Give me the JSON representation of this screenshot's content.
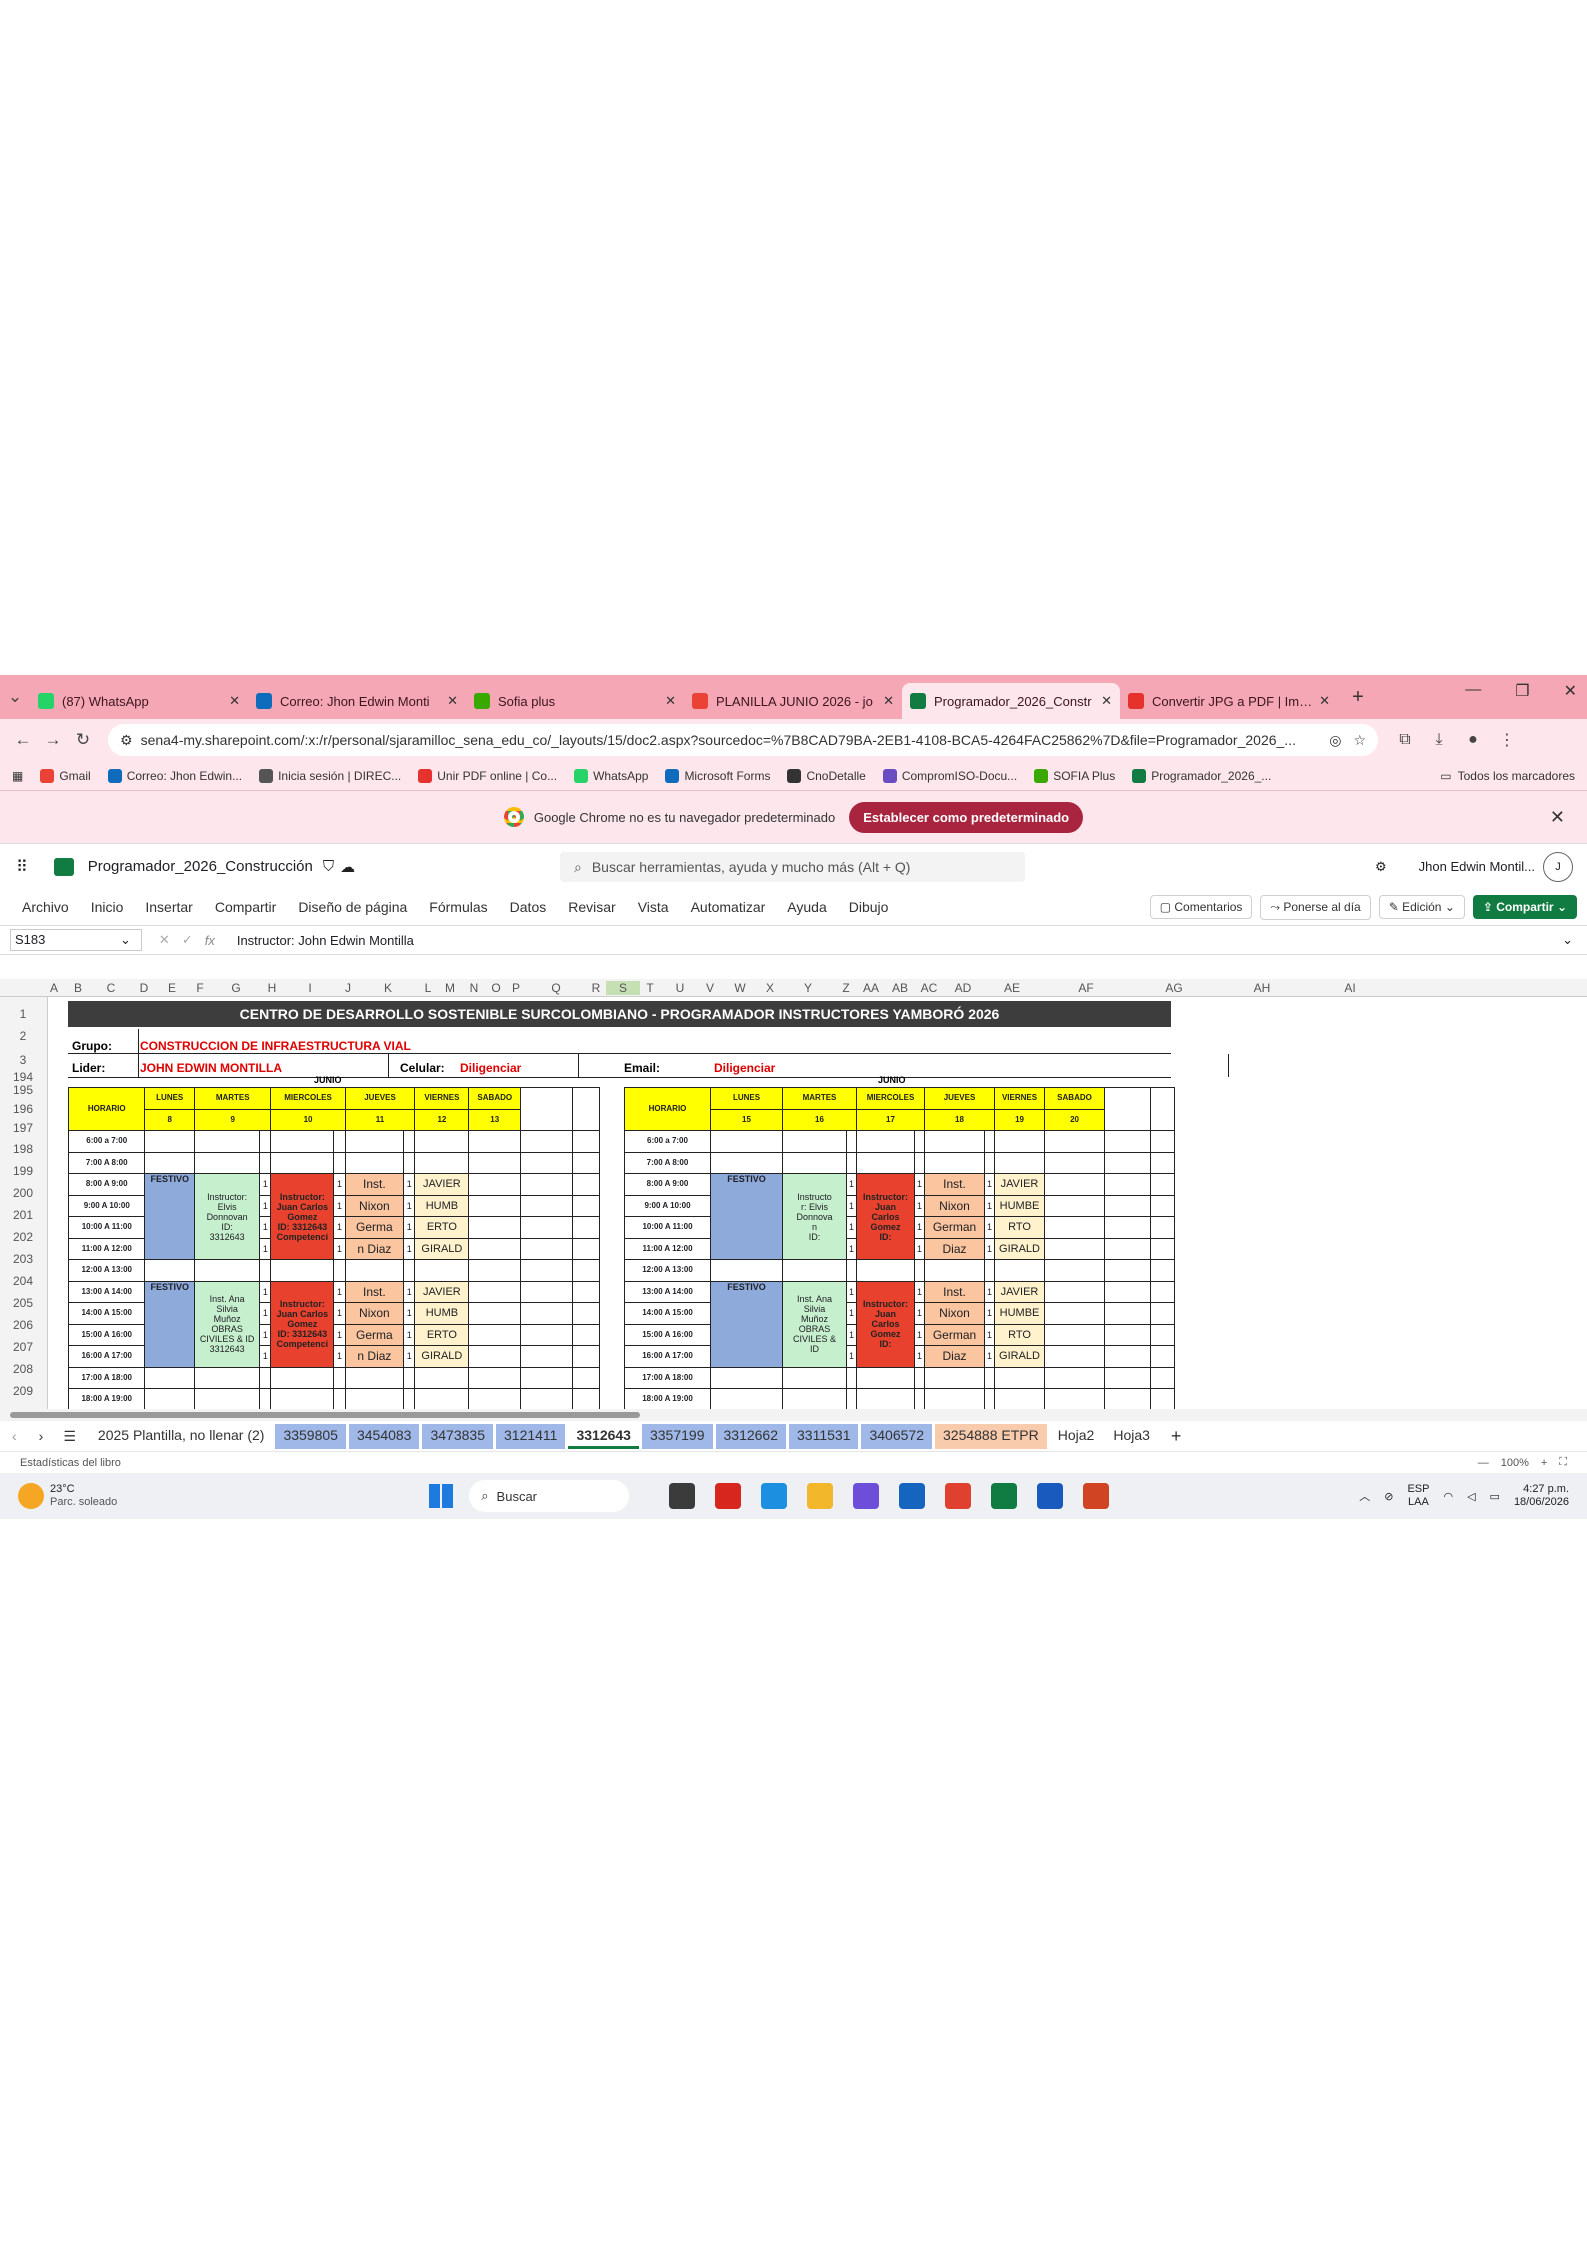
{
  "browser": {
    "tabs": [
      {
        "title": "(87) WhatsApp",
        "color": "#25d366"
      },
      {
        "title": "Correo: Jhon Edwin Monti",
        "color": "#0f6cbd"
      },
      {
        "title": "Sofia plus",
        "color": "#39a900"
      },
      {
        "title": "PLANILLA JUNIO 2026 - jo",
        "color": "#ea4335"
      },
      {
        "title": "Programador_2026_Constr",
        "color": "#107c41"
      },
      {
        "title": "Convertir JPG a PDF | Imáge",
        "color": "#e5322d"
      }
    ],
    "active_tab": 4,
    "url": "sena4-my.sharepoint.com/:x:/r/personal/sjaramilloc_sena_edu_co/_layouts/15/doc2.aspx?sourcedoc=%7B8CAD79BA-2EB1-4108-BCA5-4264FAC25862%7D&file=Programador_2026_...",
    "bookmarks": [
      "Gmail",
      "Correo: Jhon Edwin...",
      "Inicia sesión | DIREC...",
      "Unir PDF online | Co...",
      "WhatsApp",
      "Microsoft Forms",
      "CnoDetalle",
      "CompromISO-Docu...",
      "SOFIA Plus",
      "Programador_2026_..."
    ],
    "all_bookmarks": "Todos los marcadores",
    "infobar_text": "Google Chrome no es tu navegador predeterminado",
    "infobar_button": "Establecer como predeterminado"
  },
  "excel": {
    "filename": "Programador_2026_Construcción",
    "search_placeholder": "Buscar herramientas, ayuda y mucho más (Alt + Q)",
    "user": "Jhon Edwin Montil...",
    "avatar": "J",
    "ribbon_tabs": [
      "Archivo",
      "Inicio",
      "Insertar",
      "Compartir",
      "Diseño de página",
      "Fórmulas",
      "Datos",
      "Revisar",
      "Vista",
      "Automatizar",
      "Ayuda",
      "Dibujo"
    ],
    "comments": "Comentarios",
    "catchup": "Ponerse al día",
    "editing": "Edición",
    "share": "Compartir",
    "namebox": "S183",
    "formula": "Instructor: John Edwin Montilla",
    "columns": [
      "A",
      "B",
      "C",
      "D",
      "E",
      "F",
      "G",
      "H",
      "I",
      "J",
      "K",
      "L",
      "M",
      "N",
      "O",
      "P",
      "Q",
      "R",
      "S",
      "T",
      "U",
      "V",
      "W",
      "X",
      "Y",
      "Z",
      "AA",
      "AB",
      "AC",
      "AD",
      "AE",
      "AF",
      "AG",
      "AH",
      "AI"
    ],
    "rows": [
      "1",
      "2",
      "3",
      "194",
      "195",
      "196",
      "197",
      "198",
      "199",
      "200",
      "201",
      "202",
      "203",
      "204",
      "205",
      "206",
      "207",
      "208",
      "209"
    ]
  },
  "sheet": {
    "banner": "CENTRO DE DESARROLLO SOSTENIBLE SURCOLOMBIANO -  PROGRAMADOR INSTRUCTORES YAMBORÓ 2026",
    "grupo_label": "Grupo:",
    "grupo_value": "CONSTRUCCION DE INFRAESTRUCTURA VIAL",
    "lider_label": "Lider:",
    "lider_value": "JOHN EDWIN MONTILLA",
    "celular_label": "Celular:",
    "celular_value": "Diligenciar",
    "email_label": "Email:",
    "email_value": "Diligenciar",
    "month": "JUNIO",
    "horario": "HORARIO",
    "weeks": [
      {
        "days": [
          "LUNES",
          "MARTES",
          "MIERCOLES",
          "JUEVES",
          "VIERNES",
          "SABADO"
        ],
        "dates": [
          "8",
          "9",
          "10",
          "11",
          "12",
          "13"
        ],
        "hours": [
          "6:00 a 7:00",
          "7:00 A 8:00",
          "8:00 A 9:00",
          "9:00 A 10:00",
          "10:00 A 11:00",
          "11:00 A 12:00",
          "12:00 A 13:00",
          "13:00 A 14:00",
          "14:00 A 15:00",
          "15:00 A 16:00",
          "16:00 A 17:00",
          "17:00 A 18:00",
          "18:00 A 19:00"
        ],
        "festivo": "FESTIVO",
        "am": {
          "martes": [
            "Instructor:",
            "Elvis",
            "Donnovan",
            "ID:",
            "3312643"
          ],
          "miercoles": [
            "Instructor:",
            "Juan Carlos",
            "Gomez",
            "ID: 3312643",
            "Competenci"
          ],
          "jueves": [
            "Inst.",
            "Nixon",
            "Germa",
            "n Diaz"
          ],
          "viernes": [
            "JAVIER",
            "HUMB",
            "ERTO",
            "GIRALD"
          ]
        },
        "pm": {
          "martes": [
            "Inst. Ana",
            "Silvia",
            "Muñoz",
            "OBRAS",
            "CIVILES & ID",
            "3312643"
          ],
          "miercoles": [
            "Instructor:",
            "Juan Carlos",
            "Gomez",
            "ID: 3312643",
            "Competenci"
          ],
          "jueves": [
            "Inst.",
            "Nixon",
            "Germa",
            "n Diaz"
          ],
          "viernes": [
            "JAVIER",
            "HUMB",
            "ERTO",
            "GIRALD"
          ]
        }
      },
      {
        "days": [
          "LUNES",
          "MARTES",
          "MIERCOLES",
          "JUEVES",
          "VIERNES",
          "SABADO"
        ],
        "dates": [
          "15",
          "16",
          "17",
          "18",
          "19",
          "20"
        ],
        "hours": [
          "6:00 a 7:00",
          "7:00 A 8:00",
          "8:00 A 9:00",
          "9:00 A 10:00",
          "10:00 A 11:00",
          "11:00 A 12:00",
          "12:00 A 13:00",
          "13:00 A 14:00",
          "14:00 A 15:00",
          "15:00 A 16:00",
          "16:00 A 17:00",
          "17:00 A 18:00",
          "18:00 A 19:00"
        ],
        "festivo": "FESTIVO",
        "am": {
          "martes": [
            "Instructo",
            "r: Elvis",
            "Donnova",
            "n",
            "ID:"
          ],
          "miercoles": [
            "Instructor:",
            "Juan",
            "Carlos",
            "Gomez",
            "ID:"
          ],
          "jueves": [
            "Inst.",
            "Nixon",
            "German",
            "Diaz"
          ],
          "viernes": [
            "JAVIER",
            "HUMBE",
            "RTO",
            "GIRALD"
          ]
        },
        "pm": {
          "martes": [
            "Inst. Ana",
            "Silvia",
            "Muñoz",
            "OBRAS",
            "CIVILES &",
            "ID"
          ],
          "miercoles": [
            "Instructor:",
            "Juan",
            "Carlos",
            "Gomez",
            "ID:"
          ],
          "jueves": [
            "Inst.",
            "Nixon",
            "German",
            "Diaz"
          ],
          "viernes": [
            "JAVIER",
            "HUMBE",
            "RTO",
            "GIRALD"
          ]
        }
      }
    ],
    "hour_count": "1"
  },
  "sheet_tabs": [
    {
      "label": "2025 Plantilla, no llenar (2)",
      "style": "plain"
    },
    {
      "label": "3359805",
      "style": "blue"
    },
    {
      "label": "3454083",
      "style": "blue"
    },
    {
      "label": "3473835",
      "style": "blue"
    },
    {
      "label": "3121411",
      "style": "blue"
    },
    {
      "label": "3312643",
      "style": "active"
    },
    {
      "label": "3357199",
      "style": "blue"
    },
    {
      "label": "3312662",
      "style": "blue"
    },
    {
      "label": "3311531",
      "style": "blue"
    },
    {
      "label": "3406572",
      "style": "blue"
    },
    {
      "label": "3254888 ETPR",
      "style": "orange"
    },
    {
      "label": "Hoja2",
      "style": "plain"
    },
    {
      "label": "Hoja3",
      "style": "plain"
    }
  ],
  "status": {
    "left": "Estadísticas del libro",
    "zoom": "100%"
  },
  "taskbar": {
    "temp": "23°C",
    "weather": "Parc. soleado",
    "search": "Buscar",
    "lang1": "ESP",
    "lang2": "LAA",
    "time": "4:27 p.m.",
    "date": "18/06/2026",
    "apps": [
      {
        "name": "task-view",
        "color": "#3b3b3b"
      },
      {
        "name": "acrobat",
        "color": "#d7261e"
      },
      {
        "name": "edge",
        "color": "#1d8fe0"
      },
      {
        "name": "explorer",
        "color": "#f2b72b"
      },
      {
        "name": "copilot",
        "color": "#6c4ed8"
      },
      {
        "name": "store",
        "color": "#1565c0"
      },
      {
        "name": "chrome",
        "color": "#e0402f"
      },
      {
        "name": "excel",
        "color": "#107c41"
      },
      {
        "name": "word",
        "color": "#185abd"
      },
      {
        "name": "powerpoint",
        "color": "#d04423"
      }
    ]
  }
}
